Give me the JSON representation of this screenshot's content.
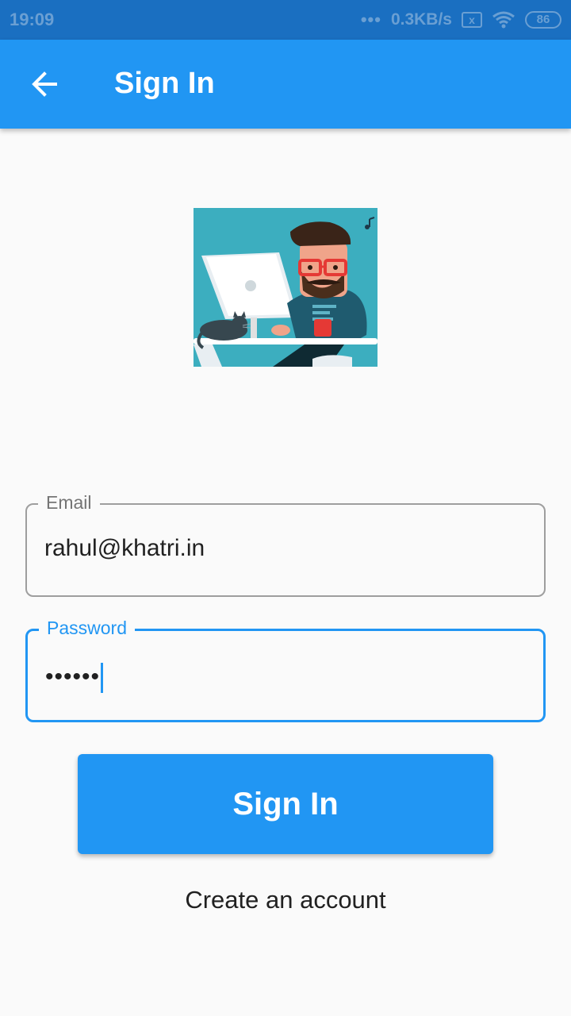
{
  "status_bar": {
    "time": "19:09",
    "dots": "•••",
    "speed": "0.3KB/s",
    "sim_icon": "x",
    "wifi_icon": "wifi-icon",
    "battery": "86"
  },
  "app_bar": {
    "back_icon": "arrow-left-icon",
    "title": "Sign In"
  },
  "form": {
    "email": {
      "label": "Email",
      "value": "rahul@khatri.in"
    },
    "password": {
      "label": "Password",
      "value": "••••••"
    }
  },
  "sign_in_button": "Sign In",
  "create_account_link": "Create an account",
  "colors": {
    "primary": "#2196f3",
    "status_bar": "#1a6fc1",
    "background": "#fafafa"
  }
}
